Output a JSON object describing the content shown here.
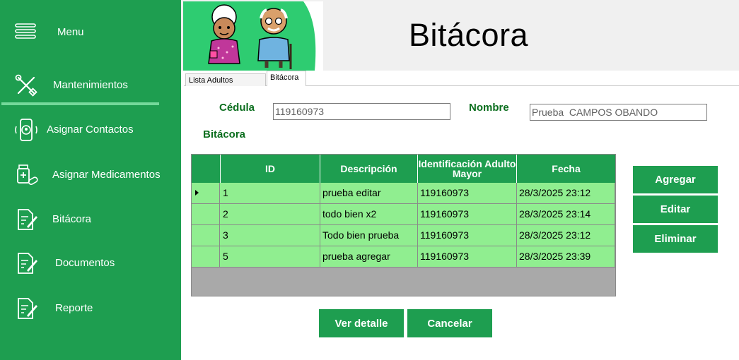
{
  "sidebar": {
    "menu_label": "Menu",
    "items": [
      {
        "label": "Mantenimientos",
        "icon": "tools-icon"
      },
      {
        "label": "Asignar Contactos",
        "icon": "phone-contact-icon"
      },
      {
        "label": "Asignar Medicamentos",
        "icon": "medicine-icon"
      },
      {
        "label": "Bitácora",
        "icon": "document-pen-icon"
      },
      {
        "label": "Documentos",
        "icon": "document-pen-icon"
      },
      {
        "label": "Reporte",
        "icon": "document-pen-icon"
      }
    ],
    "colors": {
      "background": "#1e9e50",
      "underline": "#74d99a"
    }
  },
  "header": {
    "title": "Bitácora"
  },
  "tabs": [
    {
      "label": "Lista Adultos Mayores"
    },
    {
      "label": "Bitácora"
    }
  ],
  "form": {
    "cedula_label": "Cédula",
    "cedula_value": "119160973",
    "nombre_label": "Nombre",
    "nombre_value": "Prueba  CAMPOS OBANDO",
    "bitacora_label": "Bitácora"
  },
  "grid": {
    "columns": [
      "ID",
      "Descripción",
      "Identificación Adulto Mayor",
      "Fecha"
    ],
    "rows": [
      {
        "id": "1",
        "descripcion": "prueba editar",
        "identificacion": "119160973",
        "fecha": "28/3/2025 23:12"
      },
      {
        "id": "2",
        "descripcion": "todo bien x2",
        "identificacion": "119160973",
        "fecha": "28/3/2025 23:14"
      },
      {
        "id": "3",
        "descripcion": "Todo bien prueba",
        "identificacion": "119160973",
        "fecha": "28/3/2025 23:12"
      },
      {
        "id": "5",
        "descripcion": "prueba agregar",
        "identificacion": "119160973",
        "fecha": "28/3/2025 23:39"
      }
    ],
    "colors": {
      "header": "#1e9e50",
      "row": "#90ee90",
      "empty": "#a9a9a9"
    }
  },
  "buttons": {
    "agregar": "Agregar",
    "editar": "Editar",
    "eliminar": "Eliminar",
    "ver_detalle": "Ver detalle",
    "cancelar": "Cancelar"
  }
}
